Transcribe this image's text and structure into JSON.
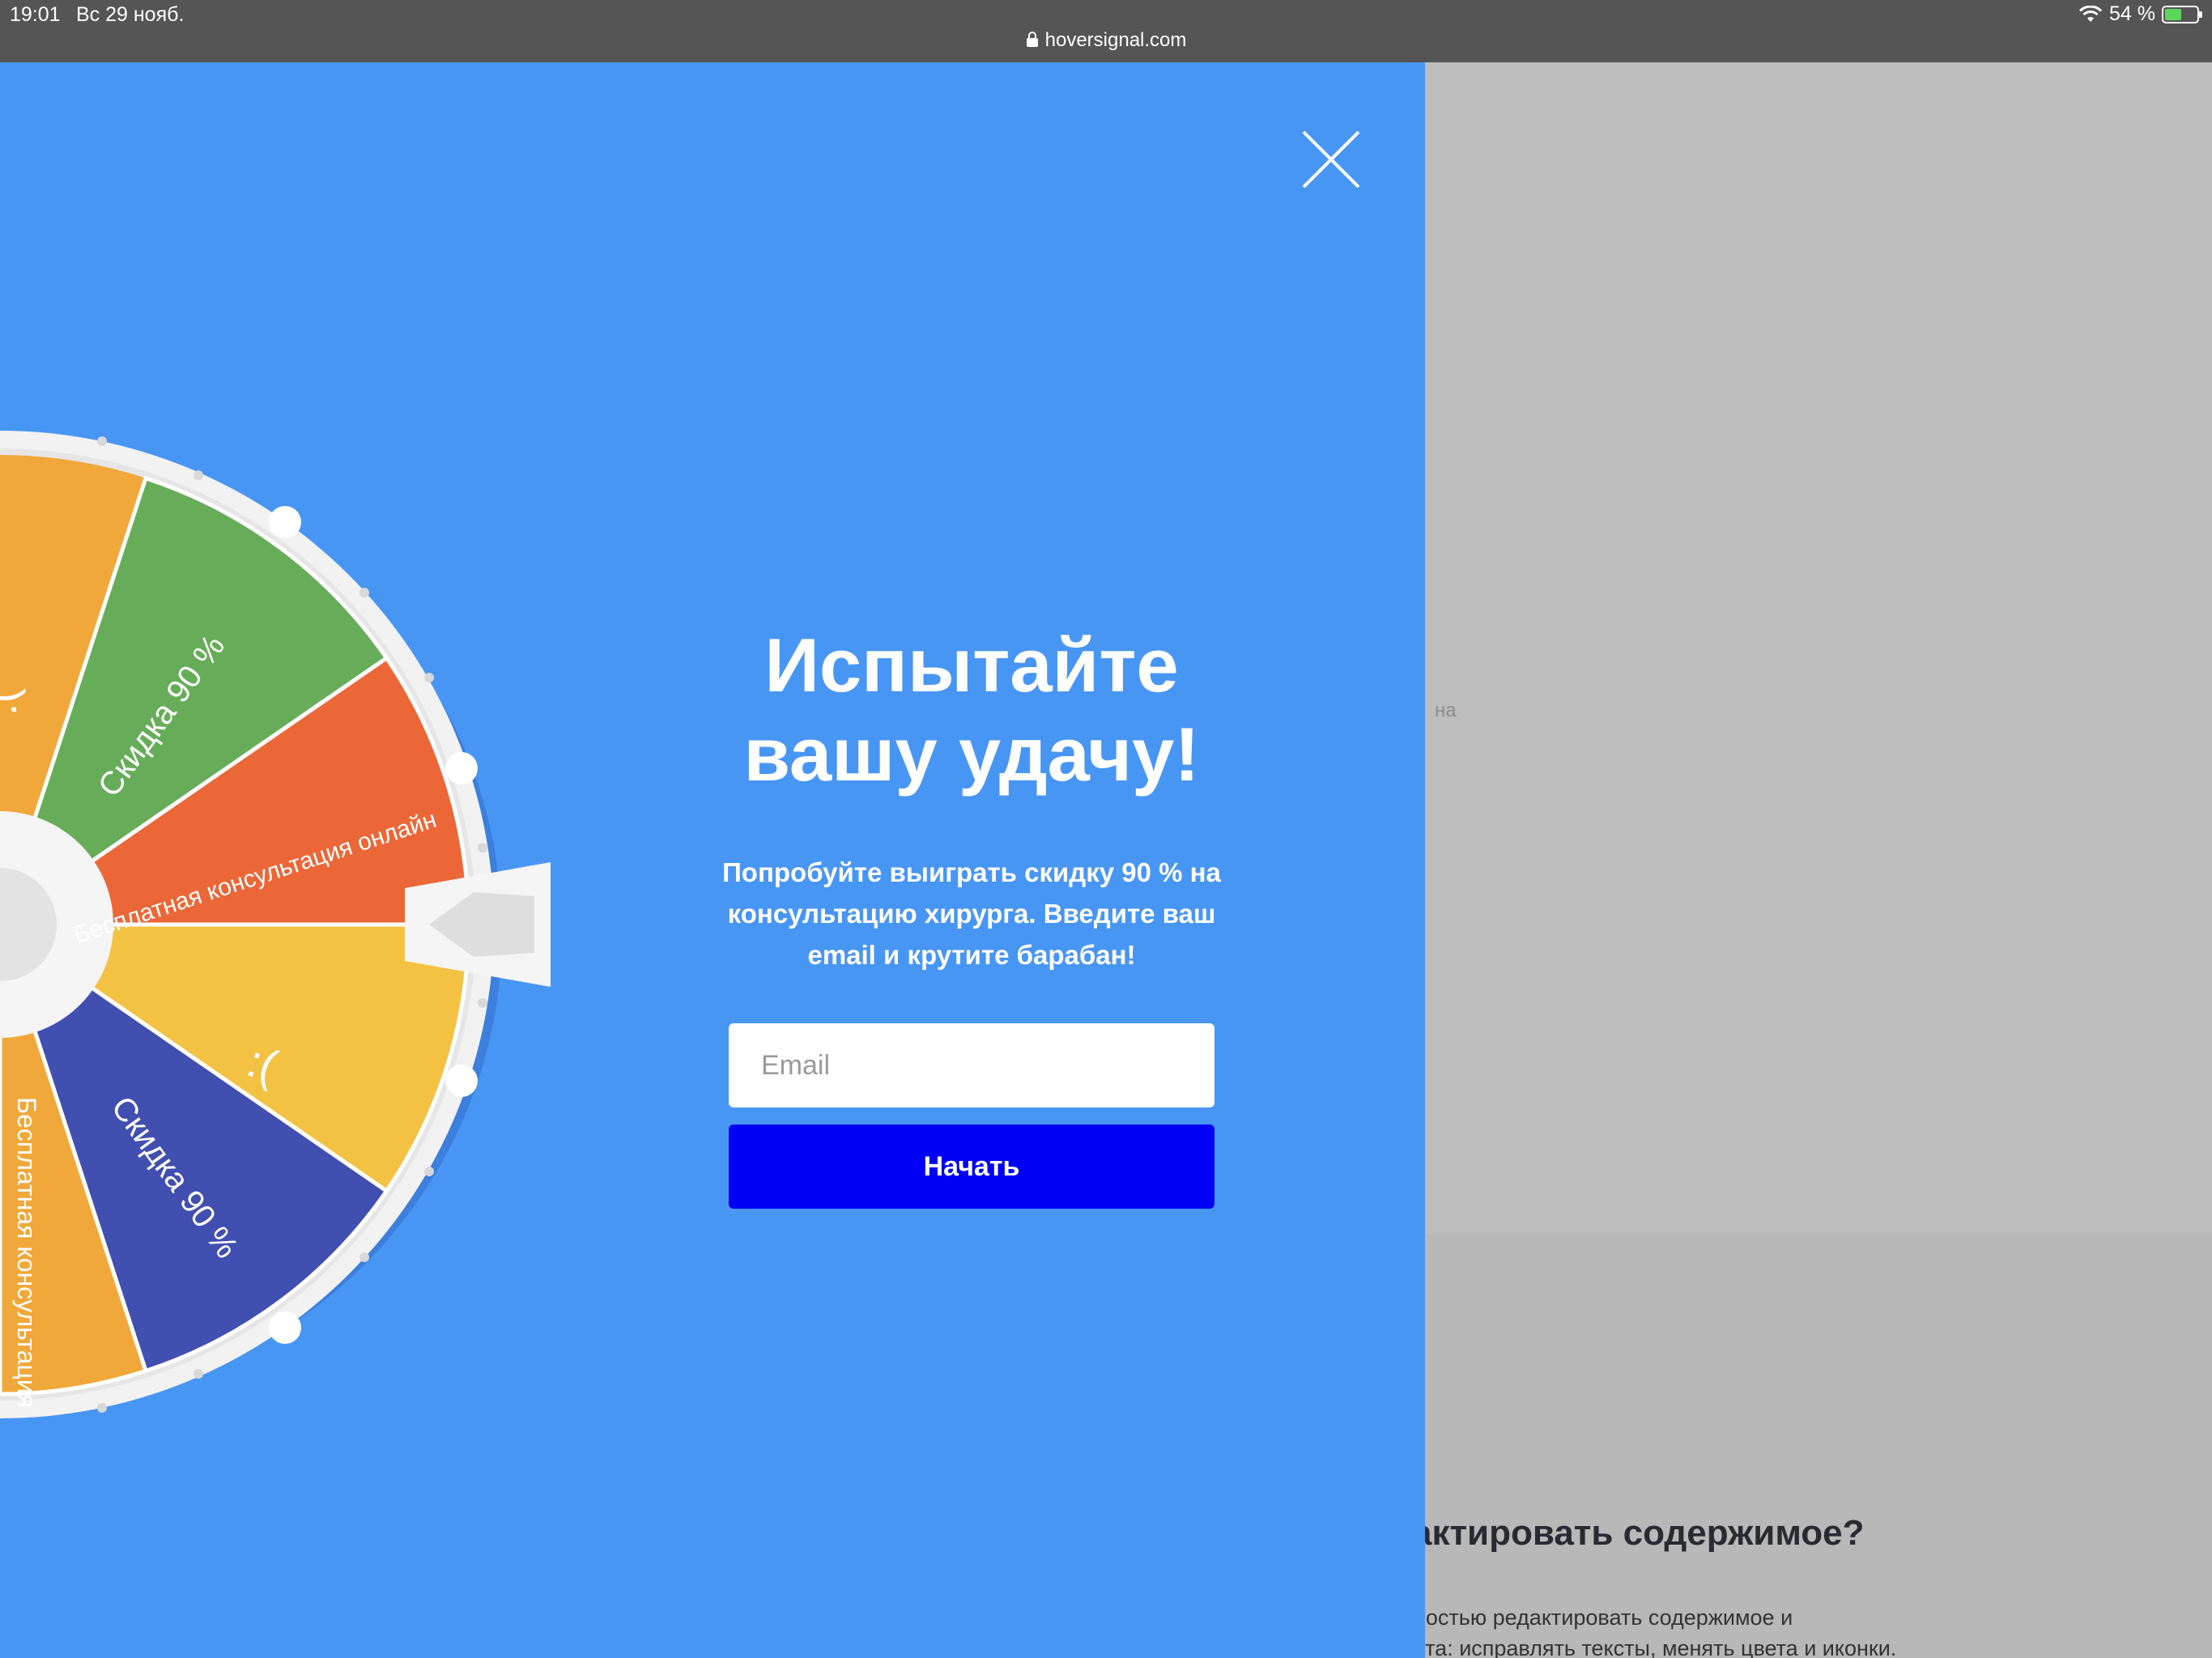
{
  "status_bar": {
    "time": "19:01",
    "date": "Вс 29 нояб.",
    "url": "hoversignal.com",
    "battery": "54 %",
    "battery_level": 0.54
  },
  "popup": {
    "title_line1": "Испытайте",
    "title_line2": "вашу удачу!",
    "description": "Попробуйте выиграть скидку 90 % на консультацию хирурга. Введите ваш email и крутите барабан!",
    "email_placeholder": "Email",
    "email_value": "",
    "start_label": "Начать",
    "accent_color": "#4896f4",
    "button_color": "#0000f5"
  },
  "wheel": {
    "segments": [
      {
        "label": "Скидка 90 %",
        "color": "#67ad59"
      },
      {
        "label": "Бесплатная консультация онлайн",
        "color": "#ec6738"
      },
      {
        "label": ":(",
        "color": "#f3c243"
      },
      {
        "label": "Скидка 90 %",
        "color": "#414fb1"
      },
      {
        "label": "Бесплатная консультация",
        "color": "#f1a83a"
      },
      {
        "label": ":(",
        "color": "#f1a83a"
      }
    ]
  },
  "background_page": {
    "fragment": "на",
    "heading": "актировать содержимое?",
    "para_line1": "ностью редактировать содержимое и",
    "para_line2": "ета: исправлять тексты, менять цвета и иконки."
  }
}
